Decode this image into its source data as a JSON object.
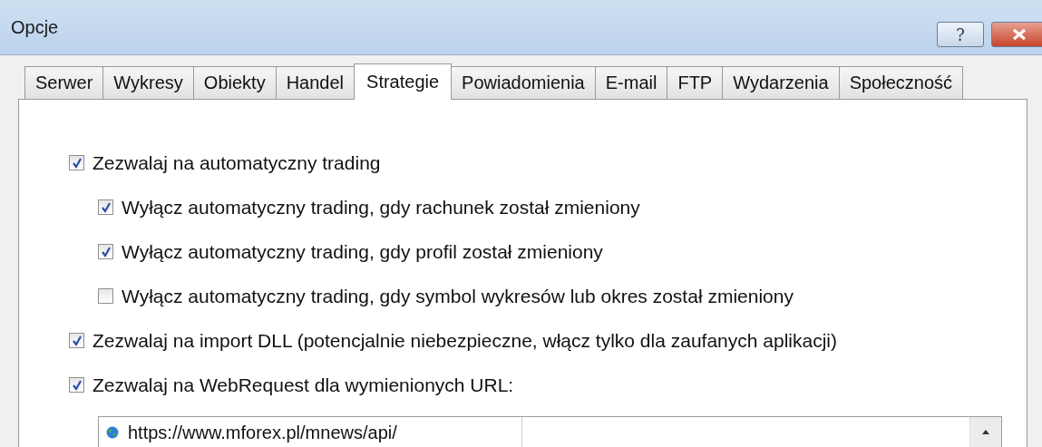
{
  "window": {
    "title": "Opcje",
    "help_label": "?"
  },
  "tabs": [
    {
      "label": "Serwer",
      "selected": false
    },
    {
      "label": "Wykresy",
      "selected": false
    },
    {
      "label": "Obiekty",
      "selected": false
    },
    {
      "label": "Handel",
      "selected": false
    },
    {
      "label": "Strategie",
      "selected": true
    },
    {
      "label": "Powiadomienia",
      "selected": false
    },
    {
      "label": "E-mail",
      "selected": false
    },
    {
      "label": "FTP",
      "selected": false
    },
    {
      "label": "Wydarzenia",
      "selected": false
    },
    {
      "label": "Społeczność",
      "selected": false
    }
  ],
  "options": [
    {
      "label": "Zezwalaj na automatyczny trading",
      "checked": true,
      "children": [
        {
          "label": "Wyłącz automatyczny trading, gdy rachunek został zmieniony",
          "checked": true
        },
        {
          "label": "Wyłącz automatyczny trading, gdy profil został zmieniony",
          "checked": true
        },
        {
          "label": "Wyłącz automatyczny trading, gdy symbol wykresów lub okres został zmieniony",
          "checked": false
        }
      ]
    },
    {
      "label": "Zezwalaj na import DLL (potencjalnie niebezpieczne, włącz tylko dla zaufanych aplikacji)",
      "checked": true
    },
    {
      "label": "Zezwalaj na WebRequest dla wymienionych URL:",
      "checked": true
    }
  ],
  "url_list": [
    {
      "url": "https://www.mforex.pl/mnews/api/"
    }
  ]
}
